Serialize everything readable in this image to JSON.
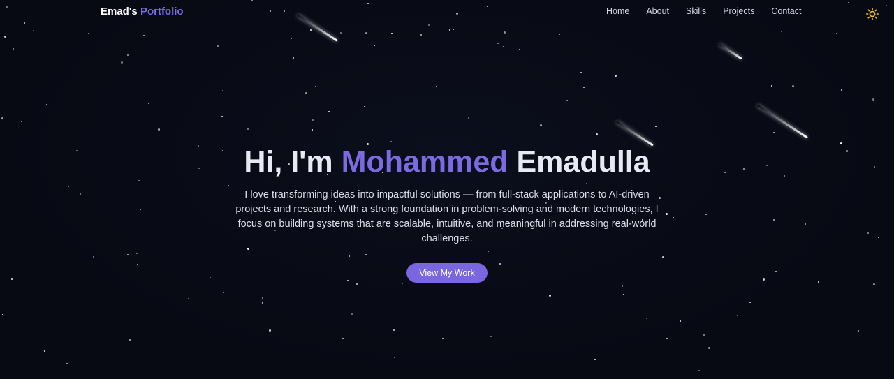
{
  "nav": {
    "brand_prefix": "Emad's",
    "brand_accent": "Portfolio",
    "links": [
      "Home",
      "About",
      "Skills",
      "Projects",
      "Contact"
    ],
    "theme_icon": "sun-icon"
  },
  "hero": {
    "greeting": "Hi, I'm",
    "first_name": "Mohammed",
    "last_name": "Emadulla",
    "intro": "I love transforming ideas into impactful solutions — from full-stack applications to AI-driven projects and research. With a strong foundation in problem-solving and modern technologies, I focus on building systems that are scalable, intuitive, and meaningful in addressing real-world challenges.",
    "cta_label": "View My Work"
  },
  "colors": {
    "background": "#070913",
    "accent": "#7b6ae0",
    "button": "#7a66de",
    "sun": "#f5c518"
  }
}
